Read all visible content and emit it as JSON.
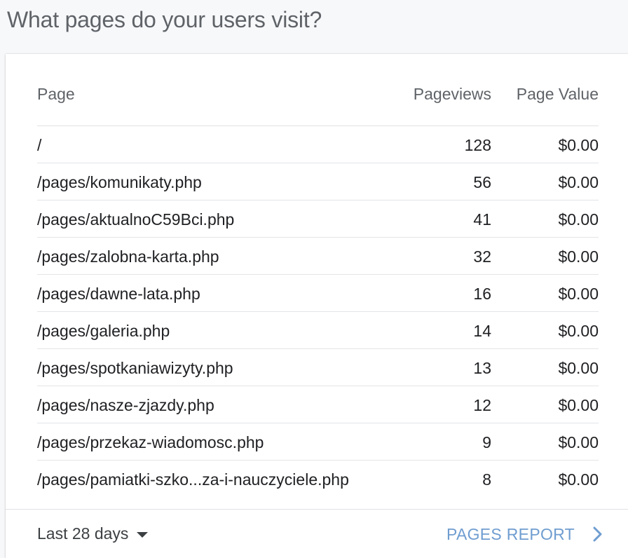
{
  "title": "What pages do your users visit?",
  "table": {
    "columns": {
      "page": "Page",
      "pageviews": "Pageviews",
      "page_value": "Page Value"
    },
    "rows": [
      {
        "page": "/",
        "pageviews": "128",
        "page_value": "$0.00"
      },
      {
        "page": "/pages/komunikaty.php",
        "pageviews": "56",
        "page_value": "$0.00"
      },
      {
        "page": "/pages/aktualnoC59Bci.php",
        "pageviews": "41",
        "page_value": "$0.00"
      },
      {
        "page": "/pages/zalobna-karta.php",
        "pageviews": "32",
        "page_value": "$0.00"
      },
      {
        "page": "/pages/dawne-lata.php",
        "pageviews": "16",
        "page_value": "$0.00"
      },
      {
        "page": "/pages/galeria.php",
        "pageviews": "14",
        "page_value": "$0.00"
      },
      {
        "page": "/pages/spotkaniawizyty.php",
        "pageviews": "13",
        "page_value": "$0.00"
      },
      {
        "page": "/pages/nasze-zjazdy.php",
        "pageviews": "12",
        "page_value": "$0.00"
      },
      {
        "page": "/pages/przekaz-wiadomosc.php",
        "pageviews": "9",
        "page_value": "$0.00"
      },
      {
        "page": "/pages/pamiatki-szko...za-i-nauczyciele.php",
        "pageviews": "8",
        "page_value": "$0.00"
      }
    ]
  },
  "footer": {
    "date_range": "Last 28 days",
    "date_range_icon": "caret-down-icon",
    "report_link": "PAGES REPORT",
    "report_link_icon": "chevron-right-icon",
    "accent_color": "#6f9dd0"
  }
}
